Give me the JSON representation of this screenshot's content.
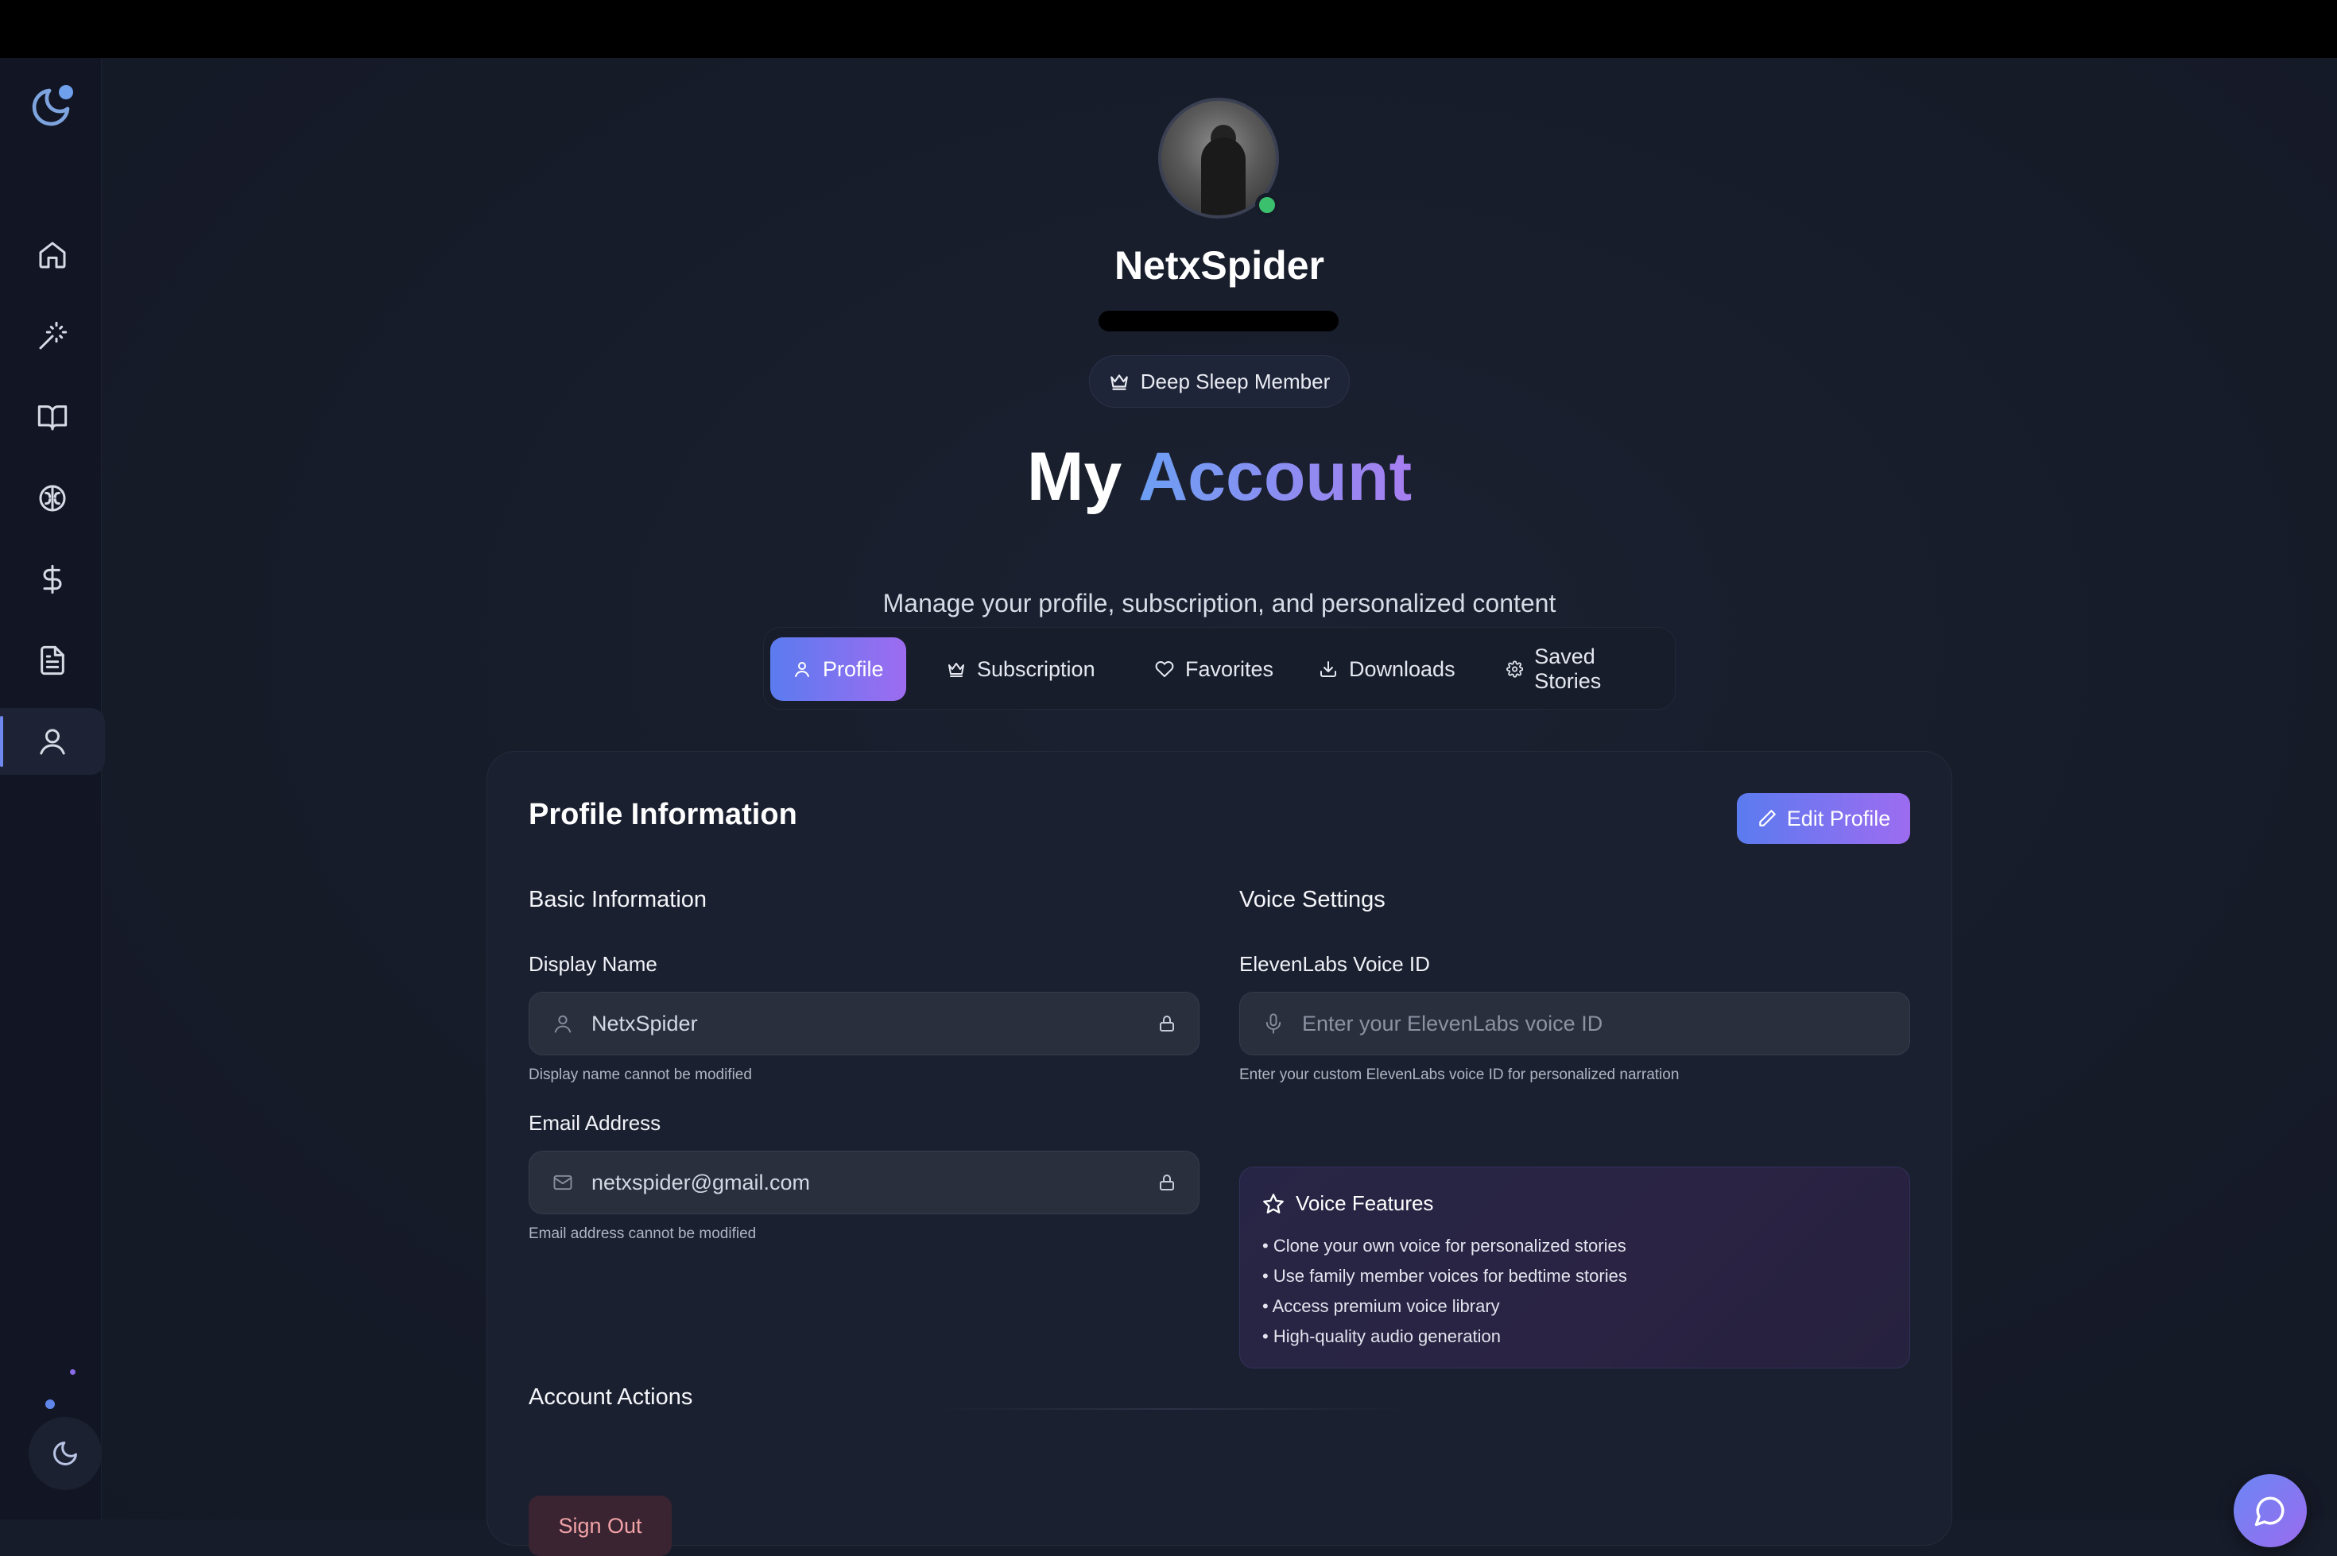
{
  "sidebar": {
    "logo_icon": "moon-icon",
    "items": [
      {
        "name": "home",
        "icon": "home-icon"
      },
      {
        "name": "create",
        "icon": "magic-wand-icon"
      },
      {
        "name": "library",
        "icon": "book-icon"
      },
      {
        "name": "mind",
        "icon": "brain-icon"
      },
      {
        "name": "pricing",
        "icon": "dollar-icon"
      },
      {
        "name": "documents",
        "icon": "document-icon"
      },
      {
        "name": "account",
        "icon": "user-icon",
        "active": true
      }
    ],
    "theme_toggle_icon": "moon-icon"
  },
  "profile": {
    "username": "NetxSpider",
    "membership_badge": "Deep Sleep Member",
    "status": "online"
  },
  "header": {
    "title_main": "My",
    "title_accent": "Account",
    "subtitle": "Manage your profile, subscription, and personalized content"
  },
  "tabs": [
    {
      "label": "Profile",
      "icon": "user-icon",
      "active": true
    },
    {
      "label": "Subscription",
      "icon": "crown-icon"
    },
    {
      "label": "Favorites",
      "icon": "heart-icon"
    },
    {
      "label": "Downloads",
      "icon": "download-icon"
    },
    {
      "label": "Saved Stories",
      "icon": "gear-icon"
    }
  ],
  "card": {
    "title": "Profile Information",
    "edit_button": "Edit Profile",
    "basic": {
      "heading": "Basic Information",
      "display_name_label": "Display Name",
      "display_name_value": "NetxSpider",
      "display_name_hint": "Display name cannot be modified",
      "email_label": "Email Address",
      "email_value": "netxspider@gmail.com",
      "email_hint": "Email address cannot be modified"
    },
    "voice": {
      "heading": "Voice Settings",
      "voice_id_label": "ElevenLabs Voice ID",
      "voice_id_placeholder": "Enter your ElevenLabs voice ID",
      "voice_id_hint": "Enter your custom ElevenLabs voice ID for personalized narration",
      "features_title": "Voice Features",
      "features": [
        "Clone your own voice for personalized stories",
        "Use family member voices for bedtime stories",
        "Access premium voice library",
        "High-quality audio generation"
      ]
    },
    "actions": {
      "heading": "Account Actions",
      "sign_out": "Sign Out"
    }
  },
  "chat_icon": "chat-bubble-icon",
  "colors": {
    "accent_start": "#5b7bef",
    "accent_end": "#9d6cf0",
    "background": "#171c2a",
    "online": "#3bc16d",
    "danger_text": "#f0a2a6"
  }
}
